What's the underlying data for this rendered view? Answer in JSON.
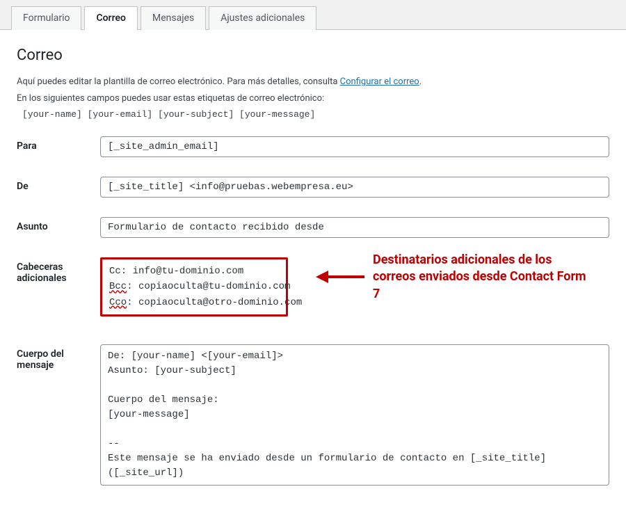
{
  "tabs": {
    "formulario": "Formulario",
    "correo": "Correo",
    "mensajes": "Mensajes",
    "ajustes": "Ajustes adicionales"
  },
  "heading": "Correo",
  "intro": {
    "line1_prefix": "Aquí puedes editar la plantilla de correo electrónico. Para más detalles, consulta ",
    "link": "Configurar el correo",
    "link_suffix": ".",
    "line2": "En los siguientes campos puedes usar estas etiquetas de correo electrónico:",
    "tags": "[your-name] [your-email] [your-subject] [your-message]"
  },
  "labels": {
    "para": "Para",
    "de": "De",
    "asunto": "Asunto",
    "cabeceras_line1": "Cabeceras",
    "cabeceras_line2": "adicionales",
    "cuerpo_line1": "Cuerpo del",
    "cuerpo_line2": "mensaje"
  },
  "values": {
    "para": "[_site_admin_email]",
    "de": "[_site_title] <info@pruebas.webempresa.eu>",
    "asunto": "Formulario de contacto recibido desde",
    "headers_cc": "Cc: info@tu-dominio.com",
    "headers_bcc_prefix": "Bcc",
    "headers_bcc_rest": ": copiaoculta@tu-dominio.com",
    "headers_cco_prefix": "Cco",
    "headers_cco_rest": ": copiaoculta@otro-dominio.com",
    "body": "De: [your-name] <[your-email]>\nAsunto: [your-subject]\n\nCuerpo del mensaje:\n[your-message]\n\n-- \nEste mensaje se ha enviado desde un formulario de contacto en [_site_title] ([_site_url])"
  },
  "annotation": "Destinatarios adicionales de los correos enviados desde Contact Form 7"
}
